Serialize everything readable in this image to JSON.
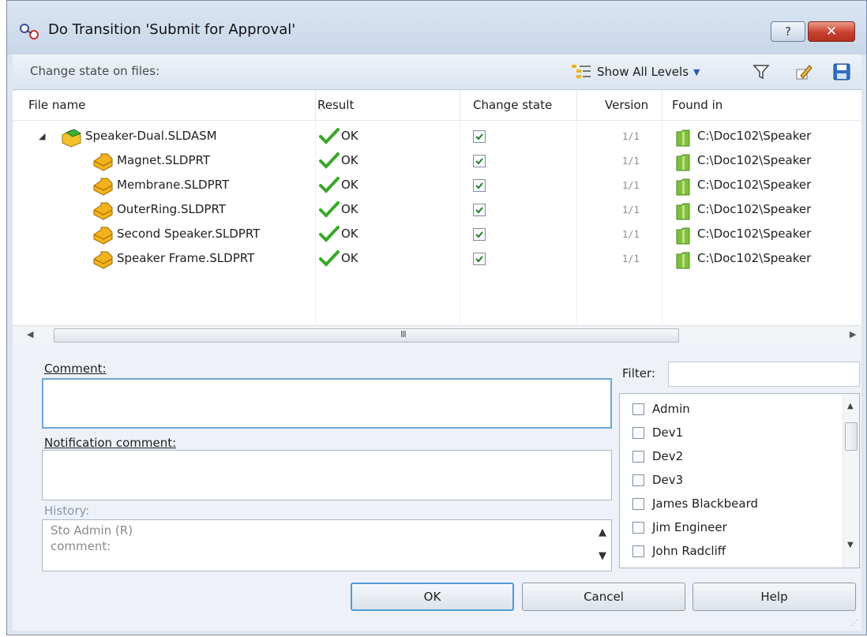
{
  "window": {
    "title": "Do Transition 'Submit for Approval'",
    "help_glyph": "?",
    "close_glyph": "✕"
  },
  "toolbar": {
    "label": "Change state on files:",
    "levels_label": "Show All Levels",
    "levels_caret": "▼"
  },
  "grid": {
    "columns": [
      "File name",
      "Result",
      "Change state",
      "Version",
      "Found in"
    ],
    "expander": "◢",
    "rows": [
      {
        "name": "Speaker-Dual.SLDASM",
        "type": "assembly",
        "result": "OK",
        "checked": true,
        "version": "1/1",
        "found_in": "C:\\Doc102\\Speaker"
      },
      {
        "name": "Magnet.SLDPRT",
        "type": "part",
        "result": "OK",
        "checked": true,
        "version": "1/1",
        "found_in": "C:\\Doc102\\Speaker"
      },
      {
        "name": "Membrane.SLDPRT",
        "type": "part",
        "result": "OK",
        "checked": true,
        "version": "1/1",
        "found_in": "C:\\Doc102\\Speaker"
      },
      {
        "name": "OuterRing.SLDPRT",
        "type": "part",
        "result": "OK",
        "checked": true,
        "version": "1/1",
        "found_in": "C:\\Doc102\\Speaker"
      },
      {
        "name": "Second Speaker.SLDPRT",
        "type": "part",
        "result": "OK",
        "checked": true,
        "version": "1/1",
        "found_in": "C:\\Doc102\\Speaker"
      },
      {
        "name": "Speaker Frame.SLDPRT",
        "type": "part",
        "result": "OK",
        "checked": true,
        "version": "1/1",
        "found_in": "C:\\Doc102\\Speaker"
      }
    ]
  },
  "hscroll": {
    "left_arrow": "◀",
    "right_arrow": "▶",
    "grip": "III"
  },
  "comment": {
    "label": "Comment:",
    "value": ""
  },
  "notification": {
    "label": "Notification comment:",
    "value": ""
  },
  "history": {
    "label": "History:",
    "line1": "Sto Admin (R)",
    "line2": "comment:",
    "up": "▲",
    "down": "▼"
  },
  "filter": {
    "label": "Filter:",
    "value": ""
  },
  "users": [
    {
      "name": "Admin",
      "checked": false
    },
    {
      "name": "Dev1",
      "checked": false
    },
    {
      "name": "Dev2",
      "checked": false
    },
    {
      "name": "Dev3",
      "checked": false
    },
    {
      "name": "James Blackbeard",
      "checked": false
    },
    {
      "name": "Jim Engineer",
      "checked": false
    },
    {
      "name": "John Radcliff",
      "checked": false
    }
  ],
  "userscroll": {
    "up": "▲",
    "down": "▼"
  },
  "buttons": {
    "ok": "OK",
    "cancel": "Cancel",
    "help": "Help"
  },
  "colors": {
    "check_green": "#3aa62a",
    "assembly_icon": "#f0c020",
    "part_icon": "#f3b21b",
    "folder": "#7fbf3a"
  }
}
